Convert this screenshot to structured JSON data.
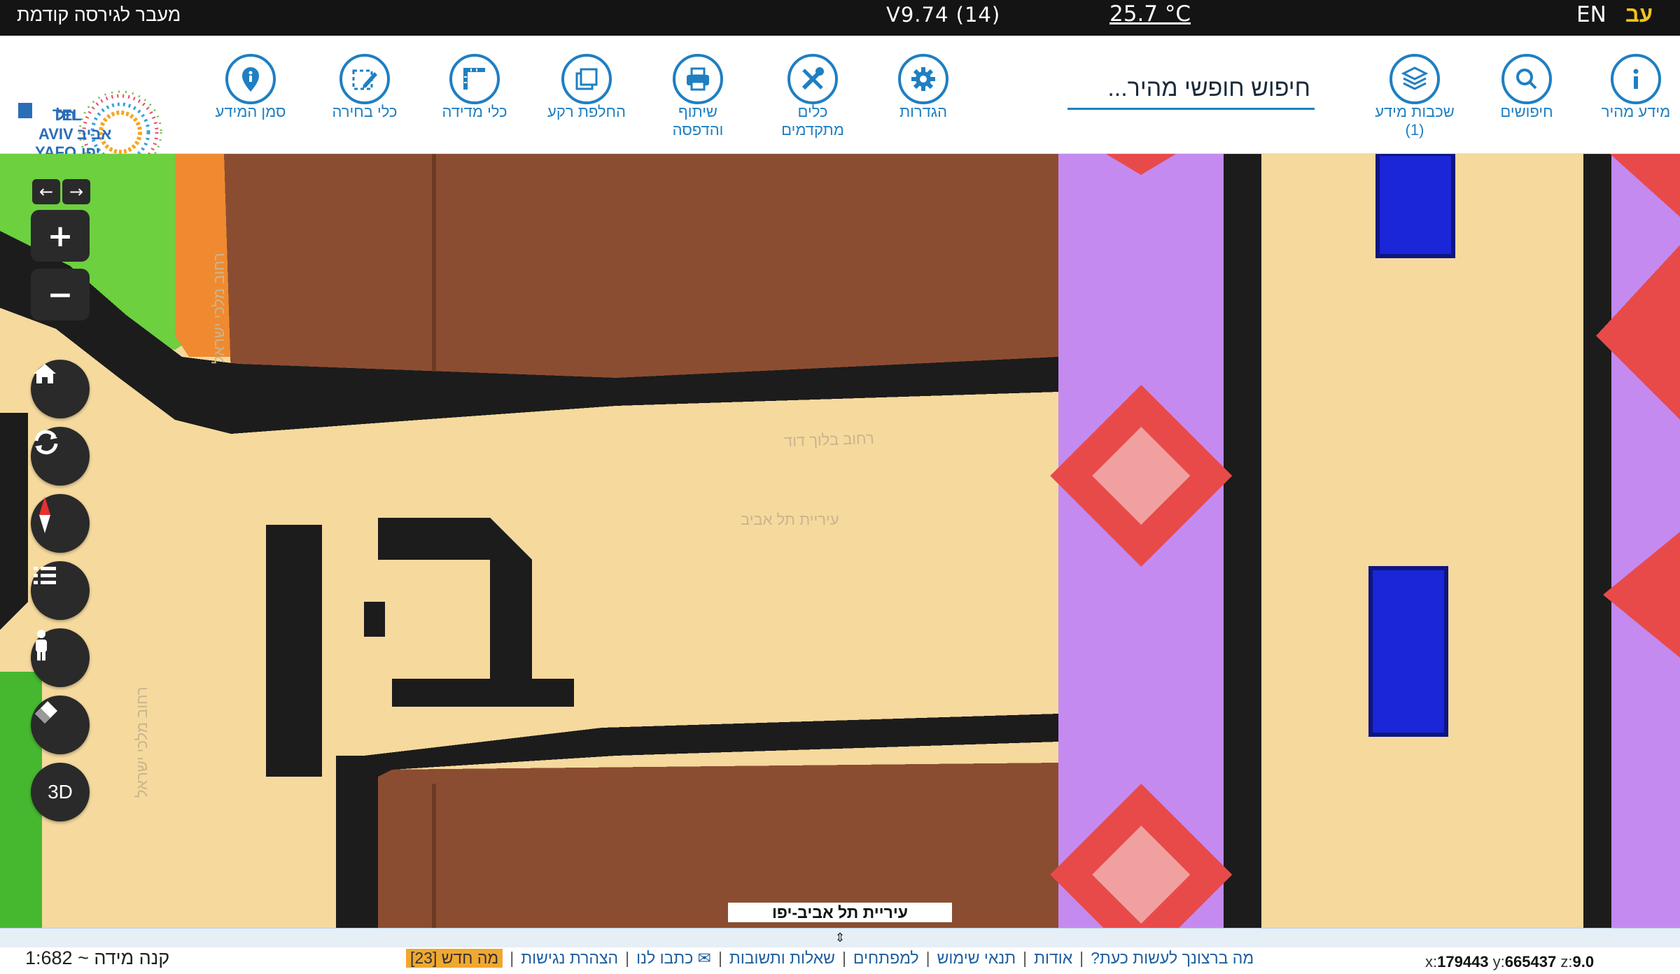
{
  "topbar": {
    "previous_version": "מעבר לגירסה קודמת",
    "version": "V9.74 (14)",
    "temperature": "25.7 °C",
    "lang_en": "EN",
    "lang_he": "עב"
  },
  "toolbar": {
    "tools": [
      {
        "label": "מידע מהיר",
        "icon": "info-icon"
      },
      {
        "label": "חיפושים",
        "icon": "search-icon"
      },
      {
        "label": "שכבות מידע\n(1)",
        "icon": "layers-icon"
      },
      {
        "label": "הגדרות",
        "icon": "gear-icon"
      },
      {
        "label": "כלים\nמתקדמים",
        "icon": "tools-icon"
      },
      {
        "label": "שיתוף\nוהדפסה",
        "icon": "printer-icon"
      },
      {
        "label": "החלפת רקע",
        "icon": "basemap-switch-icon"
      },
      {
        "label": "כלי מדידה",
        "icon": "ruler-icon"
      },
      {
        "label": "כלי בחירה",
        "icon": "select-pencil-icon"
      },
      {
        "label": "סמן המידע",
        "icon": "info-marker-icon"
      }
    ],
    "search_placeholder": "חיפוש חופשי מהיר..."
  },
  "logo": {
    "line1": "תל",
    "line2": "אביב",
    "line3": "יפו",
    "en1": "TEL",
    "en2": "AVIV",
    "en3": "YAFO"
  },
  "map": {
    "labels": {
      "street_1": "רחוב בלוך דוד",
      "city": "עיריית תל אביב",
      "street_2": "רחוב מלכי ישראל",
      "street_3": "רחוב מלכי ישראל"
    },
    "attribution": "עיריית תל אביב-יפו",
    "controls": {
      "zoom_in": "+",
      "zoom_out": "−",
      "three_d": "3D"
    },
    "colors": {
      "residential": "#f6d99d",
      "building": "#8b4d31",
      "park": "#6cd03f",
      "public": "#c48af0",
      "road_edge": "#1c1c1c",
      "red_marker": "#e84a4a",
      "blue_block": "#1a26d8"
    }
  },
  "bottom": {
    "scale": "קנה מידה ~ 1:682",
    "links": [
      "מה ברצונך לעשות כעת?",
      "אודות",
      "תנאי שימוש",
      "למפתחים",
      "שאלות ותשובות",
      "✉ כתבו לנו",
      "הצהרת נגישות"
    ],
    "news": "מה חדש [23]",
    "coords": {
      "x_label": "x:",
      "x": "179443",
      "y_label": "y:",
      "y": "665437",
      "z_label": "z:",
      "z": "9.0"
    }
  }
}
